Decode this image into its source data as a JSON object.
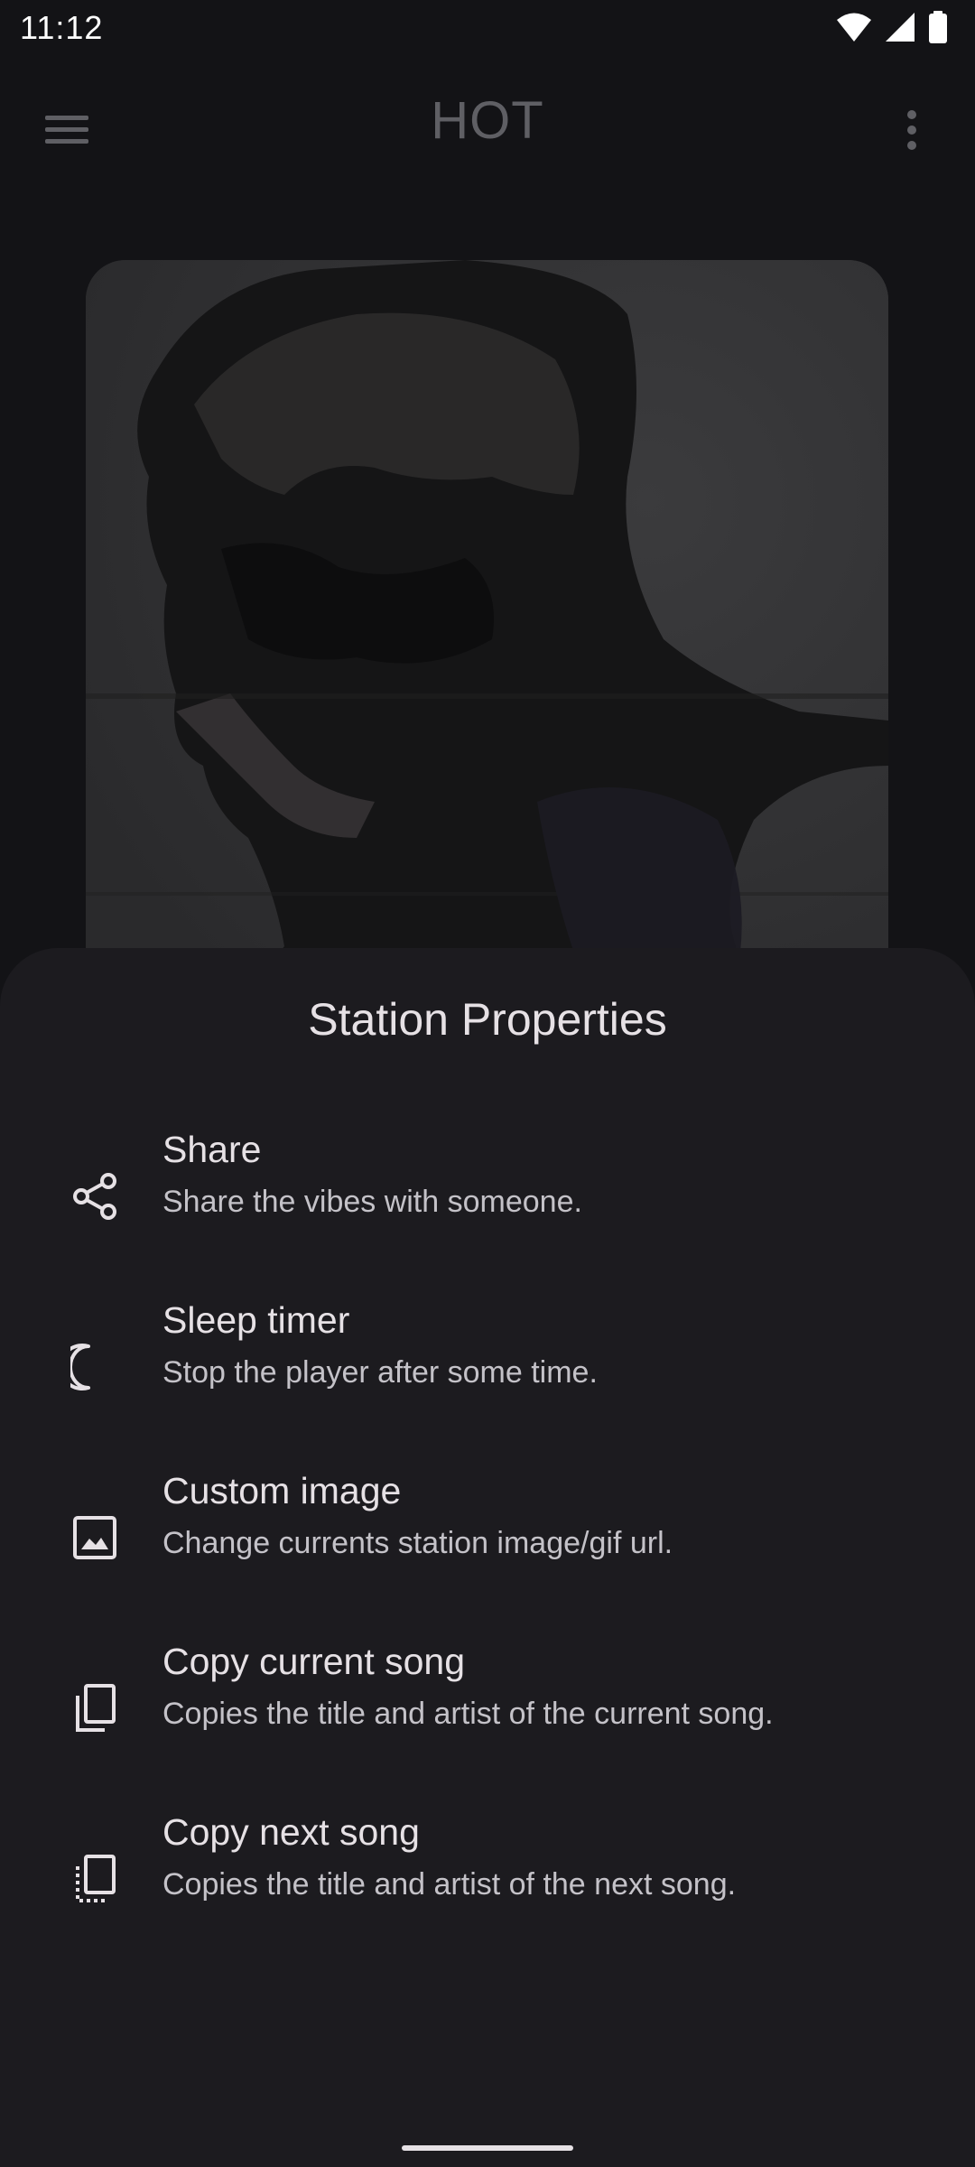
{
  "status_bar": {
    "time": "11:12",
    "icons": [
      "wifi-icon",
      "signal-icon",
      "battery-icon"
    ]
  },
  "app_bar": {
    "title": "HOT",
    "menu_icon": "hamburger-menu-icon",
    "overflow_icon": "more-vert-icon"
  },
  "artwork": {
    "description_icon": "station-artwork"
  },
  "sheet": {
    "title": "Station Properties",
    "options": [
      {
        "icon": "share-icon",
        "label": "Share",
        "subtitle": "Share the vibes with someone."
      },
      {
        "icon": "moon-icon",
        "label": "Sleep timer",
        "subtitle": "Stop the player after some time."
      },
      {
        "icon": "image-icon",
        "label": "Custom image",
        "subtitle": "Change currents station image/gif url."
      },
      {
        "icon": "copy-icon",
        "label": "Copy current song",
        "subtitle": "Copies the title and artist of the current song."
      },
      {
        "icon": "copy-dashed-icon",
        "label": "Copy next song",
        "subtitle": "Copies the title and artist of the next song."
      }
    ]
  },
  "colors": {
    "sheet_background": "#1c1b1f",
    "background": "#131316",
    "text_primary": "#e6e1e5",
    "text_secondary": "#c4c2c8",
    "title_dimmed": "#5f5f64"
  }
}
